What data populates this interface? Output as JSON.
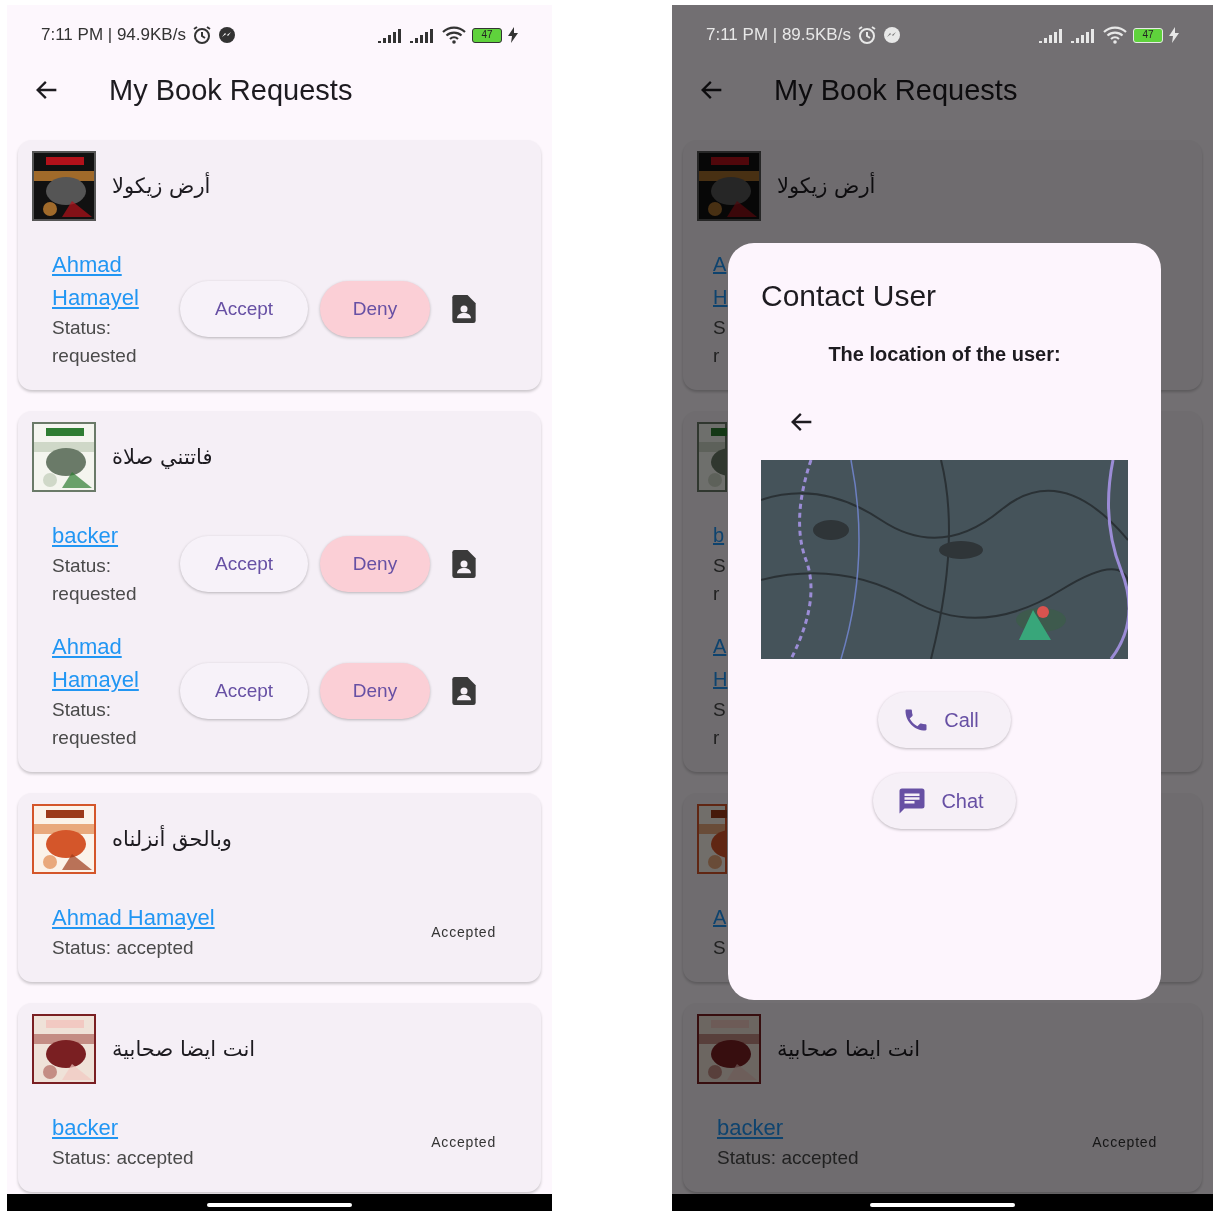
{
  "screens": [
    {
      "status_bar": {
        "time": "7:11 PM | 94.9KB/s",
        "battery": "47",
        "light_icons": false
      },
      "title": "My Book Requests",
      "books": [
        {
          "cover": {
            "kind": "picture"
          },
          "title": "أرض زيكولا",
          "requests": [
            {
              "kind": "pending",
              "name": "Ahmad Hamayel",
              "status": "Status: requested",
              "accept": "Accept",
              "deny": "Deny"
            }
          ]
        },
        {
          "cover": {
            "kind": "picture"
          },
          "title": "فاتتني صلاة",
          "requests": [
            {
              "kind": "pending",
              "name": "backer",
              "status": "Status: requested",
              "accept": "Accept",
              "deny": "Deny"
            },
            {
              "kind": "pending",
              "name": "Ahmad Hamayel",
              "status": "Status: requested",
              "accept": "Accept",
              "deny": "Deny"
            }
          ]
        },
        {
          "cover": {
            "kind": "picture"
          },
          "title": "وبالحق أنزلناه",
          "requests": [
            {
              "kind": "accepted",
              "name": "Ahmad Hamayel",
              "status": "Status: accepted",
              "label": "Accepted"
            }
          ]
        },
        {
          "cover": {
            "kind": "picture"
          },
          "title": "انت ايضا صحابية",
          "requests": [
            {
              "kind": "accepted",
              "name": "backer",
              "status": "Status: accepted",
              "label": "Accepted"
            }
          ]
        }
      ]
    },
    {
      "status_bar": {
        "time": "7:11 PM | 89.5KB/s",
        "battery": "47",
        "light_icons": true
      },
      "title": "My Book Requests",
      "books": [
        {
          "cover": {
            "kind": "picture"
          },
          "title": "أرض زيكولا",
          "requests": [
            {
              "kind": "fragment",
              "name_lines": [
                "A",
                "H"
              ],
              "status_lines": [
                "S",
                "r"
              ]
            }
          ]
        },
        {
          "cover": {
            "kind": "picture"
          },
          "requests": [
            {
              "kind": "fragment",
              "name_lines": [
                "b"
              ],
              "status_lines": [
                "S",
                "r"
              ]
            },
            {
              "kind": "fragment",
              "name_lines": [
                "A",
                "H"
              ],
              "status_lines": [
                "S",
                "r"
              ]
            }
          ]
        },
        {
          "cover": {
            "kind": "picture"
          },
          "requests": [
            {
              "kind": "fragment",
              "name_lines": [
                "A"
              ],
              "status_lines": [
                "S"
              ]
            }
          ]
        },
        {
          "cover": {
            "kind": "picture"
          },
          "title": "انت ايضا صحابية",
          "requests": [
            {
              "kind": "accepted",
              "name": "backer",
              "status": "Status: accepted",
              "label": "Accepted"
            }
          ]
        }
      ],
      "dialog": {
        "title": "Contact User",
        "subtitle": "The location of the user:",
        "map": {
          "kind": "picture"
        },
        "actions": [
          {
            "kind": "call",
            "label": "Call"
          },
          {
            "kind": "chat",
            "label": "Chat"
          }
        ]
      }
    }
  ]
}
